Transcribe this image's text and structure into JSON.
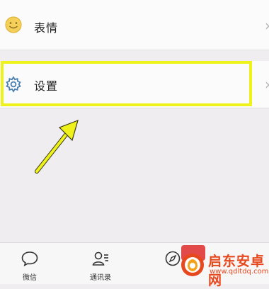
{
  "menu": {
    "items": [
      {
        "label": "表情",
        "icon": "smiley-icon"
      },
      {
        "label": "设置",
        "icon": "gear-icon"
      }
    ],
    "chevron": "›"
  },
  "tabbar": {
    "tabs": [
      {
        "label": "微信",
        "icon": "chat-bubble-icon"
      },
      {
        "label": "通讯录",
        "icon": "contacts-icon"
      },
      {
        "label": "",
        "icon": "compass-icon"
      }
    ]
  },
  "watermark": {
    "text": "启东安卓网",
    "url": "www.qdltdq.com"
  },
  "colors": {
    "highlight": "#eef21a",
    "accent_icon": "#4a7fb0",
    "smiley": "#f4cf5a",
    "badge": "#e24a4a",
    "watermark": "#e8481e"
  }
}
